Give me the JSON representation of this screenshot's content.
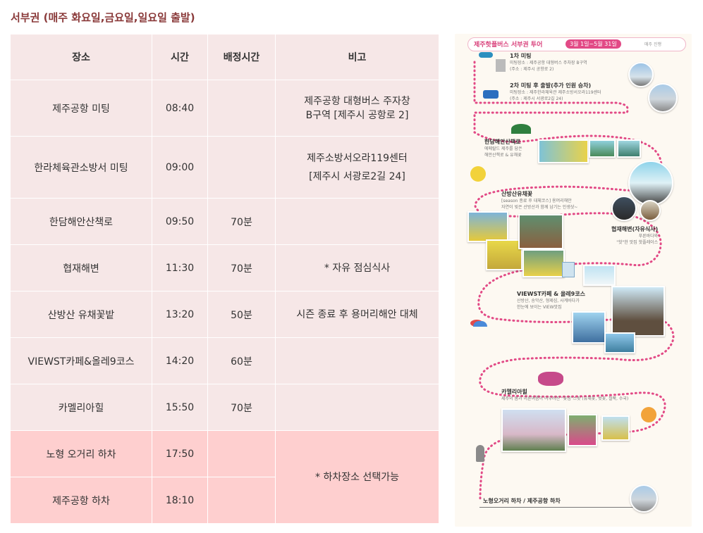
{
  "heading": "서부권 (매주 화요일,금요일,일요일 출발)",
  "table": {
    "headers": {
      "place": "장소",
      "time": "시간",
      "duration": "배정시간",
      "note": "비고"
    },
    "rows": [
      {
        "place": "제주공항 미팅",
        "time": "08:40",
        "duration": "",
        "note_line1": "제주공항 대형버스 주자창",
        "note_line2": "B구역 [제주시 공항로 2]"
      },
      {
        "place": "한라체육관소방서 미팅",
        "time": "09:00",
        "duration": "",
        "note_line1": "제주소방서오라119센터",
        "note_line2": "[제주시 서광로2길 24]"
      },
      {
        "place": "한담해안산책로",
        "time": "09:50",
        "duration": "70분",
        "note_line1": "",
        "note_line2": ""
      },
      {
        "place": "협재해변",
        "time": "11:30",
        "duration": "70분",
        "note_line1": "* 자유 점심식사",
        "note_line2": ""
      },
      {
        "place": "산방산 유채꽃밭",
        "time": "13:20",
        "duration": "50분",
        "note_line1": "시즌 종료 후 용머리해안 대체",
        "note_line2": ""
      },
      {
        "place": "VIEWST카페&올레9코스",
        "time": "14:20",
        "duration": "60분",
        "note_line1": "",
        "note_line2": ""
      },
      {
        "place": "카멜리아힐",
        "time": "15:50",
        "duration": "70분",
        "note_line1": "",
        "note_line2": ""
      }
    ],
    "dropoff_rows": [
      {
        "place": "노형 오거리 하차",
        "time": "17:50"
      },
      {
        "place": "제주공항 하차",
        "time": "18:10"
      }
    ],
    "dropoff_note": "* 하차장소 선택가능"
  },
  "map": {
    "header_title": "제주핫플버스 서부권 투어",
    "header_date": "3월 1일~5월 31일",
    "header_tag": "매주 진행",
    "stops": [
      {
        "title": "1차 미팅",
        "desc1": "미팅장소 : 제주공항 대형버스 주차장 B구역",
        "desc2": "(주소 : 제주시 공항로 2)"
      },
      {
        "title": "2차 미팅 후 출발(추가 인원 승차)",
        "desc1": "미팅장소 : 제주한라체육관 제주소방서오라119센터",
        "desc2": "(주소 : 제주시 서광로2길 24)"
      },
      {
        "title": "한담해안산책로",
        "desc1": "에메랄드 제주를 담은",
        "desc2": "해안산책로 & 유채꽃"
      },
      {
        "title": "산방산유채꽃",
        "desc1": "[season 종료 후 대체코스] 용머리해안",
        "desc2": "자연이 빚은 산방산과 함께 남기는 인생샷~"
      },
      {
        "title": "협재해변(자유식사)",
        "desc1": "푸른바다와",
        "desc2": "\"핫\"한 맛집 핫플레이스"
      },
      {
        "title": "VIEWST카페 & 올레9코스",
        "desc1": "산방산, 송악산, 형제섬, 사계바다가",
        "desc2": "한눈에 보이는 VIEW맛집"
      },
      {
        "title": "카멜리아힐",
        "desc1": "제주의 봄과 이른여름이 어우러진 \"꽃섬\"스팟 (유채꽃, 벚꽃, 철쭉, 수국)",
        "desc2": ""
      }
    ],
    "footer": "노형오거리 하차 / 제주공항 하차"
  },
  "colors": {
    "heading": "#8a3a3a",
    "row_bg": "#f6e7e7",
    "dropoff_bg": "#fecfcf",
    "accent_pink": "#e24a86"
  }
}
